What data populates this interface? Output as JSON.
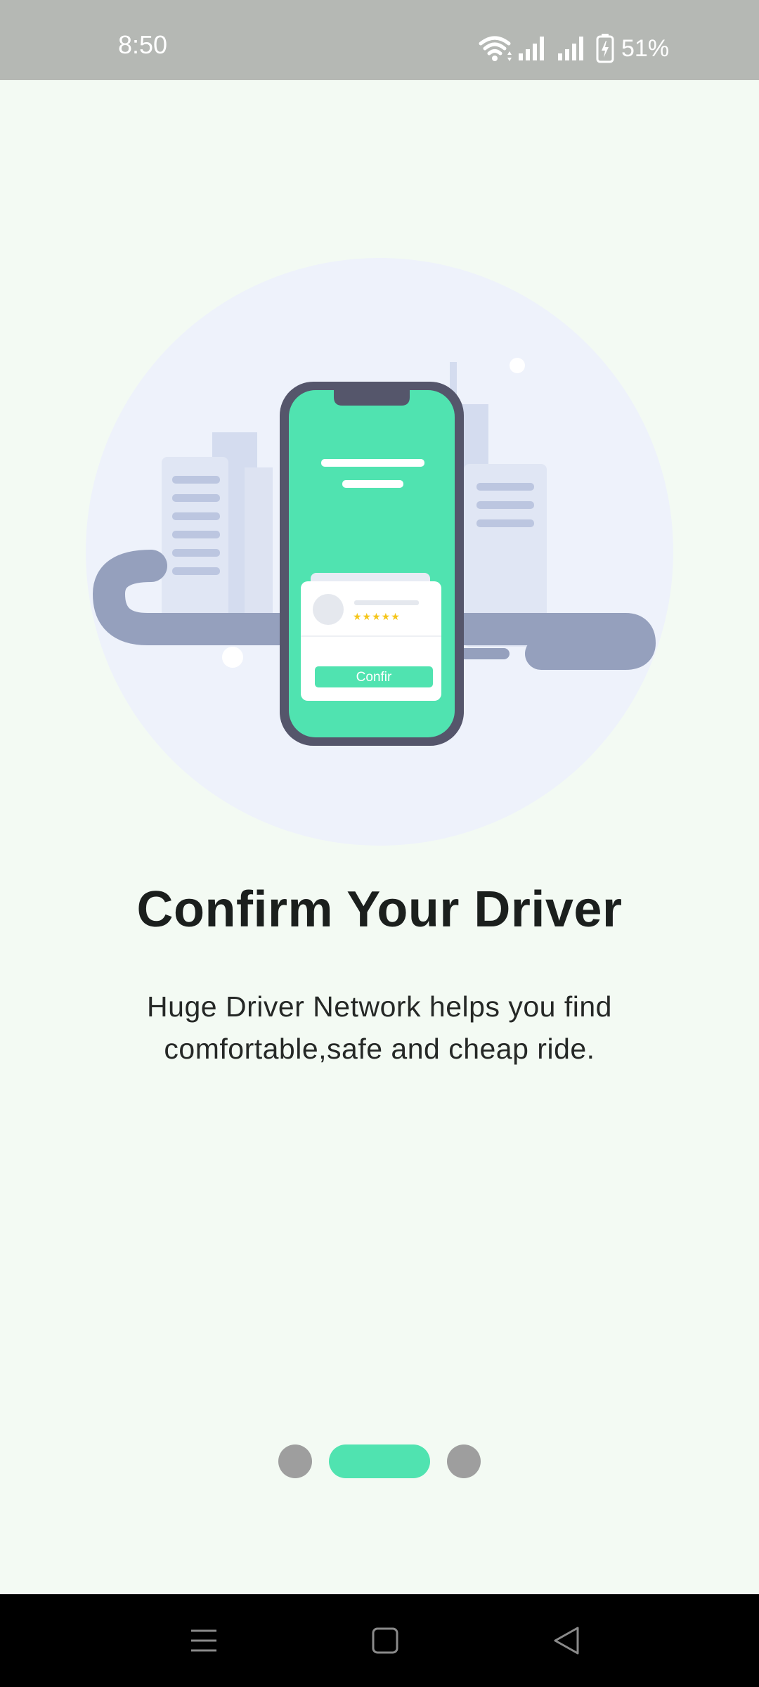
{
  "status_bar": {
    "time": "8:50",
    "battery": "51%"
  },
  "onboarding": {
    "title": "Confirm Your Driver",
    "subtitle": "Huge Driver Network helps you find comfortable,safe and cheap ride.",
    "illustration_button_label": "Confir",
    "rating_stars": "★★★★★",
    "page_count": 3,
    "current_page": 2
  },
  "colors": {
    "accent": "#50e3b0",
    "background": "#f3faf3",
    "inactive_dot": "#9e9e9e",
    "status_bar": "#b5b8b4",
    "star": "#f5c518"
  },
  "nav_bar": {
    "icons": [
      "menu-icon",
      "home-icon",
      "back-icon"
    ]
  }
}
